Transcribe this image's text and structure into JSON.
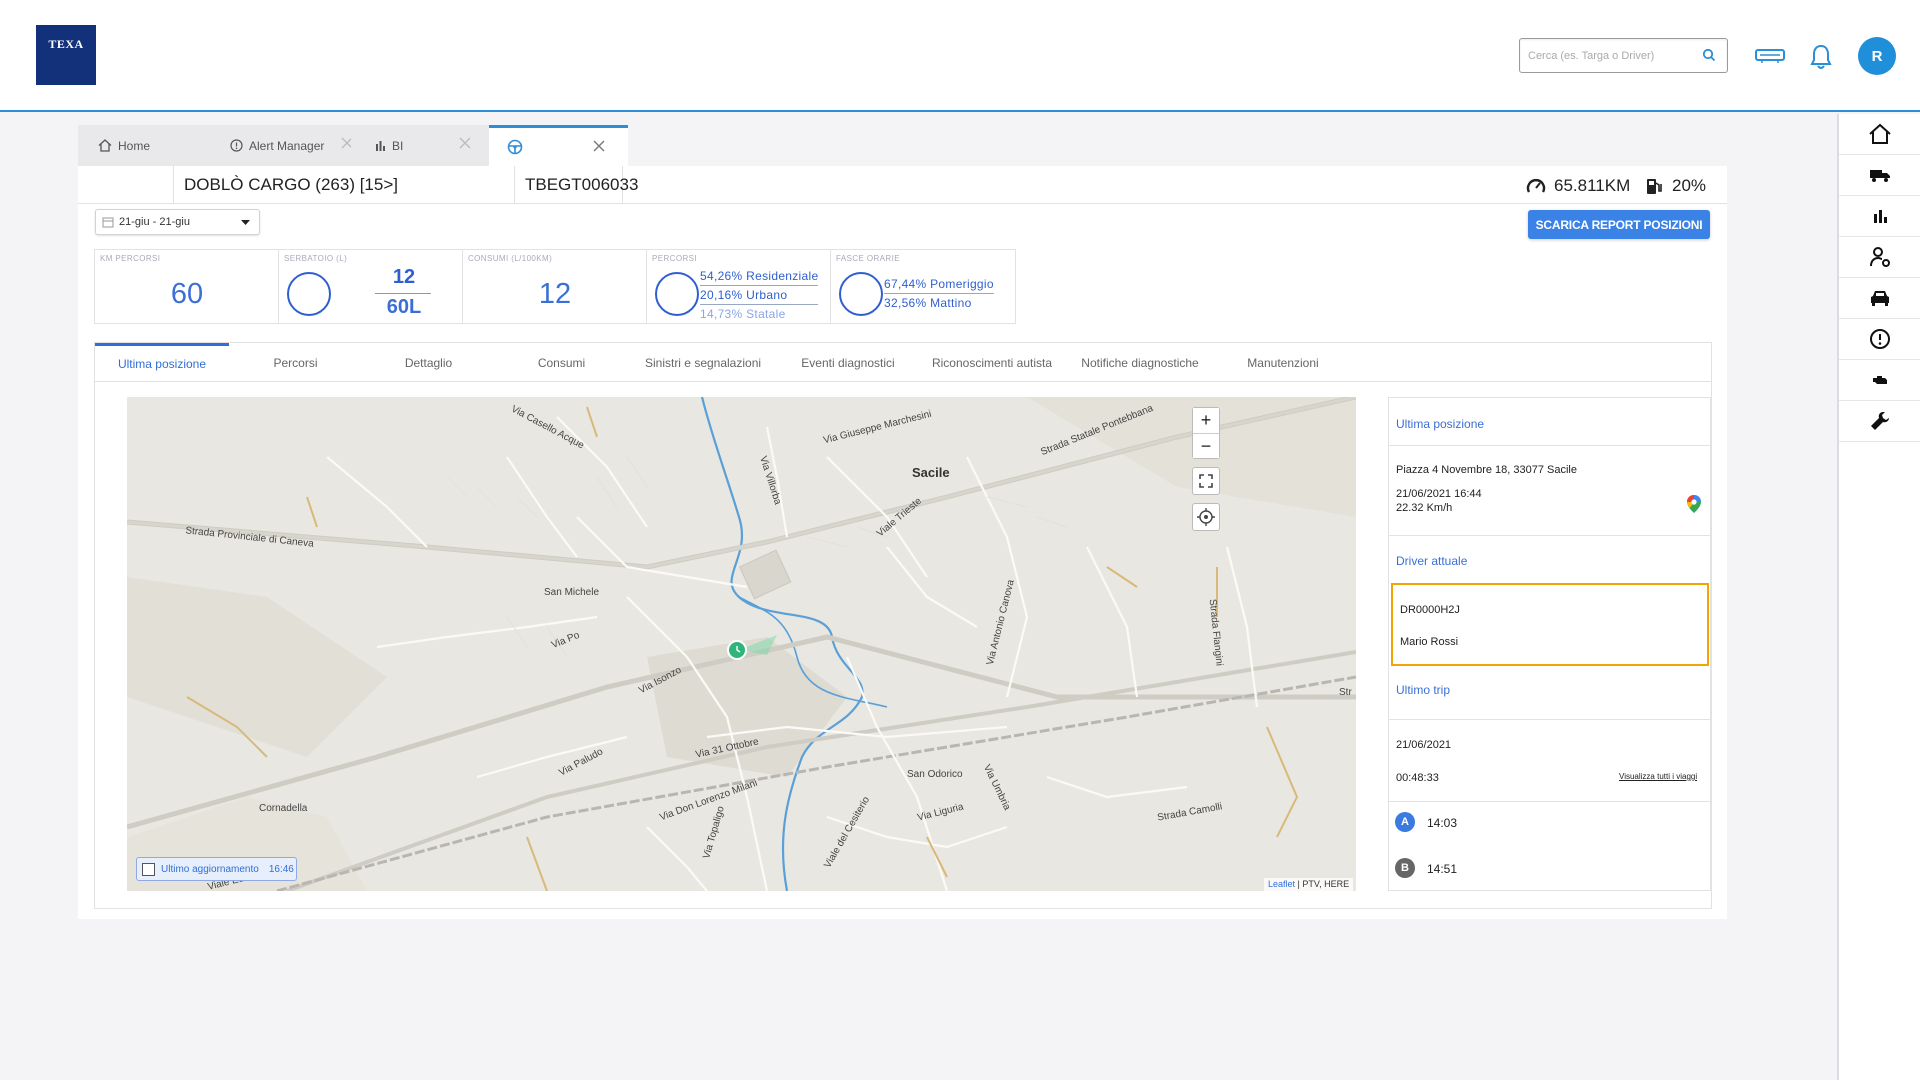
{
  "header": {
    "logo_text": "TEXA",
    "search_placeholder": "Cerca (es. Targa o Driver)",
    "avatar_initial": "R"
  },
  "tabs": [
    {
      "label": "Home",
      "icon": "home-icon"
    },
    {
      "label": "Alert Manager",
      "icon": "alert-icon"
    },
    {
      "label": "BI",
      "icon": "bar-chart-icon"
    },
    {
      "label": "",
      "icon": "steering-wheel-icon",
      "active": true
    }
  ],
  "vehicle": {
    "name": "DOBLÒ CARGO (263) [15>]",
    "plate": "TBEGT006033",
    "km": "65.811KM",
    "fuel": "20%"
  },
  "filters": {
    "date_range": "21-giu - 21-giu"
  },
  "actions": {
    "download_label": "SCARICA REPORT POSIZIONI"
  },
  "kpis": {
    "km": {
      "title": "KM PERCORSI",
      "value": "60"
    },
    "tank": {
      "title": "SERBATOIO (L)",
      "value": "12",
      "max": "60L"
    },
    "consumption": {
      "title": "CONSUMI (L/100KM)",
      "value": "12"
    },
    "routes": {
      "title": "PERCORSI",
      "rows": [
        "54,26% Residenziale",
        "20,16% Urbano",
        "14,73% Statale"
      ]
    },
    "timebands": {
      "title": "FASCE ORARIE",
      "rows": [
        "67,44% Pomeriggio",
        "32,56% Mattino"
      ]
    }
  },
  "subtabs": [
    "Ultima posizione",
    "Percorsi",
    "Dettaglio",
    "Consumi",
    "Sinistri e segnalazioni",
    "Eventi diagnostici",
    "Riconoscimenti autista",
    "Notifiche diagnostiche",
    "Manutenzioni"
  ],
  "map": {
    "labels": {
      "sacile": "Sacile",
      "caselo": "Via Casello Acque",
      "marchesini": "Via Giuseppe Marchesini",
      "pontebbana": "Strada Statale Pontebbana",
      "villorba": "Via Villorba",
      "trieste": "Viale Trieste",
      "caneva": "Strada Provinciale di Caneva",
      "sanmichele": "San Michele",
      "viapo": "Via Po",
      "isonzo": "Via Isonzo",
      "canova": "Via Antonio Canova",
      "flangini": "Strada Flangini",
      "ottobre": "Via 31 Ottobre",
      "paludo": "Via Paludo",
      "milani": "Via Don Lorenzo Milani",
      "sanodorico": "San Odorico",
      "umbria": "Via Umbria",
      "liguria": "Via Liguria",
      "camolli": "Strada Camolli",
      "cornadella": "Cornadella",
      "topaligo": "Via Topaligo",
      "cesiterio": "Viale del Cesiterio",
      "europa": "Viale Europa",
      "str": "Str"
    },
    "last_update_label": "Ultimo aggiornamento",
    "last_update_time": "16:46",
    "attribution_leaflet": "Leaflet",
    "attribution_rest": "| PTV, HERE",
    "zoom_in": "+",
    "zoom_out": "−"
  },
  "info": {
    "position_title": "Ultima posizione",
    "address": "Piazza 4 Novembre 18, 33077 Sacile",
    "datetime": "21/06/2021 16:44",
    "speed": "22.32 Km/h",
    "driver_title": "Driver attuale",
    "driver_id": "DR0000H2J",
    "driver_name": "Mario Rossi",
    "trip_title": "Ultimo trip",
    "trip_date": "21/06/2021",
    "trip_duration": "00:48:33",
    "trip_link": "Visualizza tutti i viaggi",
    "stop_a_label": "A",
    "stop_a_time": "14:03",
    "stop_b_label": "B",
    "stop_b_time": "14:51"
  },
  "colors": {
    "accent": "#2a8fd6",
    "kpi_blue": "#2e5fd0",
    "button_blue": "#3b82e6",
    "driver_highlight": "#f0a500",
    "logo_navy": "#13307a"
  }
}
